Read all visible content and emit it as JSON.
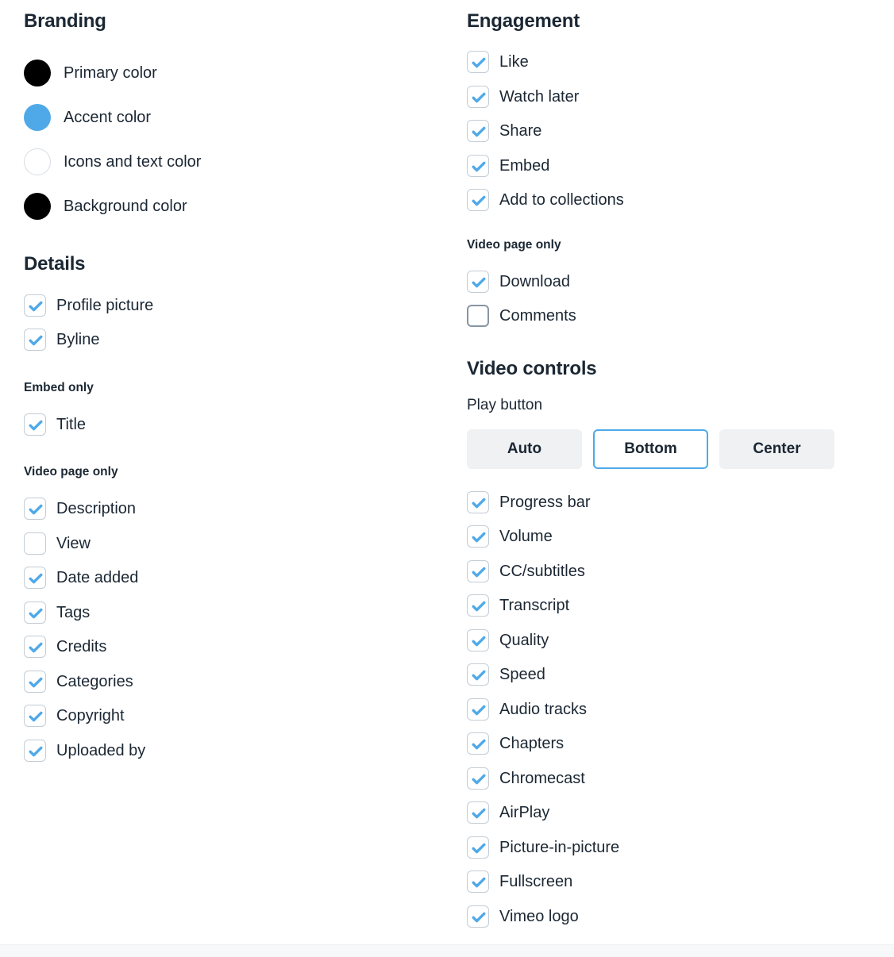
{
  "branding": {
    "title": "Branding",
    "swatches": [
      {
        "label": "Primary color",
        "color": "#000000",
        "bordered": false
      },
      {
        "label": "Accent color",
        "color": "#4fa9e8",
        "bordered": false
      },
      {
        "label": "Icons and text color",
        "color": "#ffffff",
        "bordered": true
      },
      {
        "label": "Background color",
        "color": "#000000",
        "bordered": false
      }
    ]
  },
  "details": {
    "title": "Details",
    "items": [
      {
        "label": "Profile picture",
        "checked": true
      },
      {
        "label": "Byline",
        "checked": true
      }
    ],
    "embed_only": {
      "title": "Embed only",
      "items": [
        {
          "label": "Title",
          "checked": true
        }
      ]
    },
    "video_page_only": {
      "title": "Video page only",
      "items": [
        {
          "label": "Description",
          "checked": true
        },
        {
          "label": "View",
          "checked": false
        },
        {
          "label": "Date added",
          "checked": true
        },
        {
          "label": "Tags",
          "checked": true
        },
        {
          "label": "Credits",
          "checked": true
        },
        {
          "label": "Categories",
          "checked": true
        },
        {
          "label": "Copyright",
          "checked": true
        },
        {
          "label": "Uploaded by",
          "checked": true
        }
      ]
    }
  },
  "engagement": {
    "title": "Engagement",
    "items": [
      {
        "label": "Like",
        "checked": true
      },
      {
        "label": "Watch later",
        "checked": true
      },
      {
        "label": "Share",
        "checked": true
      },
      {
        "label": "Embed",
        "checked": true
      },
      {
        "label": "Add to collections",
        "checked": true
      }
    ],
    "video_page_only": {
      "title": "Video page only",
      "items": [
        {
          "label": "Download",
          "checked": true
        },
        {
          "label": "Comments",
          "checked": false,
          "focused": true
        }
      ]
    }
  },
  "video_controls": {
    "title": "Video controls",
    "play_button": {
      "label": "Play button",
      "options": [
        "Auto",
        "Bottom",
        "Center"
      ],
      "selected": "Bottom"
    },
    "items": [
      {
        "label": "Progress bar",
        "checked": true
      },
      {
        "label": "Volume",
        "checked": true
      },
      {
        "label": "CC/subtitles",
        "checked": true
      },
      {
        "label": "Transcript",
        "checked": true
      },
      {
        "label": "Quality",
        "checked": true
      },
      {
        "label": "Speed",
        "checked": true
      },
      {
        "label": "Audio tracks",
        "checked": true
      },
      {
        "label": "Chapters",
        "checked": true
      },
      {
        "label": "Chromecast",
        "checked": true
      },
      {
        "label": "AirPlay",
        "checked": true
      },
      {
        "label": "Picture-in-picture",
        "checked": true
      },
      {
        "label": "Fullscreen",
        "checked": true
      },
      {
        "label": "Vimeo logo",
        "checked": true
      }
    ]
  },
  "colors": {
    "accent": "#4fa9e8",
    "text": "#1b2733",
    "checkbox_border": "#c3cdd6",
    "checkbox_border_focused": "#8795a3",
    "button_bg": "#f0f1f3"
  }
}
